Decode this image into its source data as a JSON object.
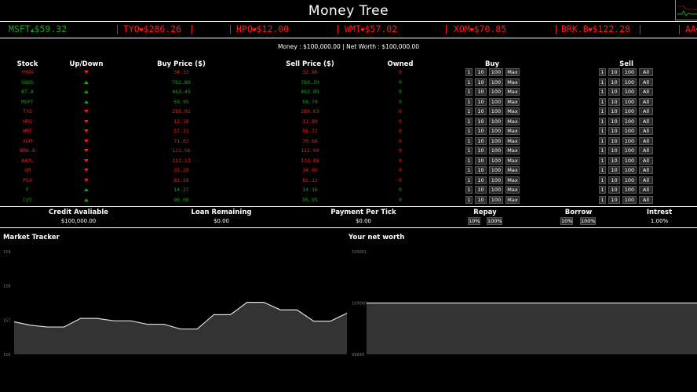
{
  "app": {
    "title": "Money Tree"
  },
  "ticker": [
    {
      "symbol": "MSFT",
      "dir": "up",
      "price": "$59.32"
    },
    {
      "symbol": "TYO",
      "dir": "down",
      "price": "$286.26"
    },
    {
      "symbol": "HPQ",
      "dir": "down",
      "price": "$12.00"
    },
    {
      "symbol": "WMT",
      "dir": "down",
      "price": "$57.02"
    },
    {
      "symbol": "XOM",
      "dir": "down",
      "price": "$70.85"
    },
    {
      "symbol": "BRK.B",
      "dir": "down",
      "price": "$122.28"
    },
    {
      "symbol": "AA",
      "dir": "down",
      "price": ""
    }
  ],
  "summary": {
    "money_label": "Money",
    "money": "$100,000.00",
    "networth_label": "Net Worth",
    "networth": "$100,000.00"
  },
  "table": {
    "headers": {
      "stock": "Stock",
      "updown": "Up/Down",
      "buy_price": "Buy Price ($)",
      "sell_price": "Sell Price ($)",
      "owned": "Owned",
      "buy": "Buy",
      "sell": "Sell"
    },
    "buy_buttons": [
      "1",
      "10",
      "100",
      "Max"
    ],
    "sell_buttons": [
      "1",
      "10",
      "100",
      "All"
    ],
    "rows": [
      {
        "symbol": "YHOO",
        "dir": "down",
        "buy": "34.33",
        "sell": "32.86",
        "owned": "0"
      },
      {
        "symbol": "GOOG",
        "dir": "up",
        "buy": "762.89",
        "sell": "760.39",
        "owned": "0"
      },
      {
        "symbol": "BT.A",
        "dir": "up",
        "buy": "463.45",
        "sell": "462.89",
        "owned": "0"
      },
      {
        "symbol": "MSFT",
        "dir": "up",
        "buy": "59.95",
        "sell": "58.70",
        "owned": "0"
      },
      {
        "symbol": "TYO",
        "dir": "down",
        "buy": "286.91",
        "sell": "286.03",
        "owned": "0"
      },
      {
        "symbol": "HPQ",
        "dir": "down",
        "buy": "12.10",
        "sell": "11.89",
        "owned": "0"
      },
      {
        "symbol": "WMT",
        "dir": "down",
        "buy": "57.31",
        "sell": "56.72",
        "owned": "0"
      },
      {
        "symbol": "XOM",
        "dir": "down",
        "buy": "71.02",
        "sell": "70.68",
        "owned": "0"
      },
      {
        "symbol": "BRK.B",
        "dir": "down",
        "buy": "122.56",
        "sell": "122.00",
        "owned": "0"
      },
      {
        "symbol": "AAPL",
        "dir": "down",
        "buy": "111.13",
        "sell": "110.88",
        "owned": "0"
      },
      {
        "symbol": "GM",
        "dir": "down",
        "buy": "35.20",
        "sell": "34.60",
        "owned": "0"
      },
      {
        "symbol": "PSX",
        "dir": "down",
        "buy": "82.26",
        "sell": "82.12",
        "owned": "0"
      },
      {
        "symbol": "F",
        "dir": "up",
        "buy": "14.27",
        "sell": "14.16",
        "owned": "0"
      },
      {
        "symbol": "CVS",
        "dir": "up",
        "buy": "96.08",
        "sell": "95.95",
        "owned": "0"
      }
    ]
  },
  "credit": {
    "credit_label": "Credit Avaliable",
    "credit_value": "$100,000.00",
    "loan_label": "Loan Remaining",
    "loan_value": "$0.00",
    "ppt_label": "Payment Per Tick",
    "ppt_value": "$0.00",
    "repay_label": "Repay",
    "repay_buttons": [
      "10%",
      "100%"
    ],
    "borrow_label": "Borrow",
    "borrow_buttons": [
      "10%",
      "100%"
    ],
    "interest_label": "Intrest",
    "interest_value": "1.00%"
  },
  "charts": {
    "market_title": "Market Tracker",
    "networth_title": "Your net worth"
  },
  "chart_data": [
    {
      "type": "area",
      "title": "Market Tracker",
      "y_ticks": [
        "159",
        "158",
        "157",
        "156"
      ],
      "ylim": [
        156,
        159
      ],
      "values": [
        156.95,
        156.85,
        156.8,
        156.8,
        157.05,
        157.05,
        156.98,
        156.98,
        156.88,
        156.88,
        156.74,
        156.74,
        157.16,
        157.16,
        157.52,
        157.52,
        157.3,
        157.3,
        156.97,
        156.97,
        157.2
      ]
    },
    {
      "type": "area",
      "title": "Your net worth",
      "y_ticks": [
        "100001",
        "100000",
        "99999"
      ],
      "ylim": [
        99999,
        100001
      ],
      "values": [
        100000,
        100000
      ]
    }
  ],
  "colors": {
    "up": "#1aa31a",
    "down": "#ff1a1a",
    "area": "#333333",
    "line": "#dddddd"
  }
}
